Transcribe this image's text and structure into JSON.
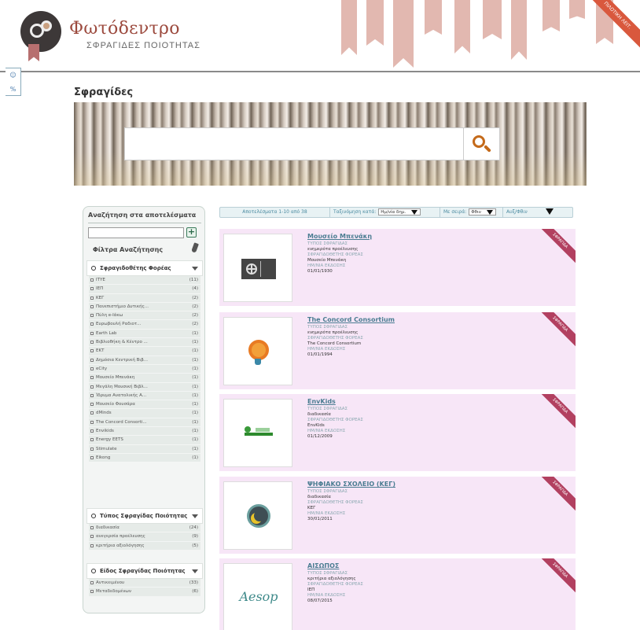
{
  "header": {
    "site_title": "Φωτόδεντρο",
    "site_subtitle": "ΣΦΡΑΓΙΔΕΣ ΠΟΙΟΤΗΤΑΣ",
    "corner_ribbon": "ΠΙΛΟΤΙΚΗ ΛΕΙΤ.",
    "side_widget": [
      "☺",
      "%"
    ]
  },
  "page_title": "Σφραγίδες",
  "search": {
    "value": "",
    "placeholder": ""
  },
  "filters": {
    "title": "Αναζήτηση στα αποτελέσματα",
    "search_value": "",
    "add_label": "+",
    "label": "Φίλτρα Αναζήτησης",
    "groups": [
      {
        "title": "Σφραγιδοθέτης Φορέας",
        "items": [
          {
            "label": "ΙΤΥΕ",
            "count": "(11)"
          },
          {
            "label": "ΙΕΠ",
            "count": "(4)"
          },
          {
            "label": "ΚΕΓ",
            "count": "(2)"
          },
          {
            "label": "Πανεπιστήμιο Δυτικής...",
            "count": "(2)"
          },
          {
            "label": "Πύλη e-Ιάκω",
            "count": "(2)"
          },
          {
            "label": "Ευρωβουλή Ραδιοτ...",
            "count": "(2)"
          },
          {
            "label": "Earth Lab",
            "count": "(1)"
          },
          {
            "label": "Βιβλιοθήκη & Κέντρο ...",
            "count": "(1)"
          },
          {
            "label": "ΕΚΤ",
            "count": "(1)"
          },
          {
            "label": "Δημόσια Κεντρική Βιβ...",
            "count": "(1)"
          },
          {
            "label": "eCity",
            "count": "(1)"
          },
          {
            "label": "Μουσείο Μπενάκη",
            "count": "(1)"
          },
          {
            "label": "Μεγάλη Μουσική Βιβλ...",
            "count": "(1)"
          },
          {
            "label": "Ίδρυμα Ανατολικής Α...",
            "count": "(1)"
          },
          {
            "label": "Μουσείο Φουσάρα",
            "count": "(1)"
          },
          {
            "label": "dMinds",
            "count": "(1)"
          },
          {
            "label": "The Concord Consorti...",
            "count": "(1)"
          },
          {
            "label": "Envikids",
            "count": "(1)"
          },
          {
            "label": "Energy EETS",
            "count": "(1)"
          },
          {
            "label": "Stimulate",
            "count": "(1)"
          },
          {
            "label": "Eikong",
            "count": "(1)"
          }
        ]
      },
      {
        "title": "Τύπος Σφραγίδας Ποιότητας",
        "items": [
          {
            "label": "διαδικασία",
            "count": "(24)"
          },
          {
            "label": "ανεγερσία προέλευσης",
            "count": "(9)"
          },
          {
            "label": "κριτήρια αξιολόγησης",
            "count": "(5)"
          }
        ]
      },
      {
        "title": "Είδος Σφραγίδας Ποιότητας",
        "items": [
          {
            "label": "Αντικειμένου",
            "count": "(33)"
          },
          {
            "label": "Μεταδεδομένων",
            "count": "(6)"
          }
        ]
      }
    ]
  },
  "toolbar": {
    "results_text": "Αποτελέσματα 1-10 από 38",
    "sort_label": "Ταξινόμηση κατά:",
    "sort_value": "Ημ/νία δημ.",
    "order_label": "Με σειρά:",
    "order_value": "Φθιν",
    "direction_label": "Αυξ/Φθιν"
  },
  "results": [
    {
      "title": "Μουσείο Μπενάκη",
      "type_label": "ΤΥΠΟΣ ΣΦΡΑΓΙΔΑΣ",
      "type_value": "ενημερότα προέλευσης",
      "org_label": "ΣΦΡΑΓΙΔΟΘΕΤΗΣ ΦΟΡΕΑΣ",
      "org_value": "Μουσείο Μπενάκη",
      "date_label": "ΗΜ/ΝΙΑ ΕΚΔΟΣΗΣ",
      "date_value": "01/01/1930",
      "ribbon": "ΣΦΡΑΓΙΔΑ",
      "thumb": "museum-logo"
    },
    {
      "title": "The Concord Consortium",
      "type_label": "ΤΥΠΟΣ ΣΦΡΑΓΙΔΑΣ",
      "type_value": "ενημερότα προέλευσης",
      "org_label": "ΣΦΡΑΓΙΔΟΘΕΤΗΣ ΦΟΡΕΑΣ",
      "org_value": "The Concord Consortium",
      "date_label": "ΗΜ/ΝΙΑ ΕΚΔΟΣΗΣ",
      "date_value": "01/01/1994",
      "ribbon": "ΣΦΡΑΓΙΔΑ",
      "thumb": "bulb-logo"
    },
    {
      "title": "EnvKids",
      "type_label": "ΤΥΠΟΣ ΣΦΡΑΓΙΔΑΣ",
      "type_value": "διαδικασία",
      "org_label": "ΣΦΡΑΓΙΔΟΘΕΤΗΣ ΦΟΡΕΑΣ",
      "org_value": "EnvKids",
      "date_label": "ΗΜ/ΝΙΑ ΕΚΔΟΣΗΣ",
      "date_value": "01/12/2009",
      "ribbon": "ΣΦΡΑΓΙΔΑ",
      "thumb": "kids-logo"
    },
    {
      "title": "ΨΗΦΙΑΚΟ ΣΧΟΛΕΙΟ (ΚΕΓ)",
      "type_label": "ΤΥΠΟΣ ΣΦΡΑΓΙΔΑΣ",
      "type_value": "διαδικασία",
      "org_label": "ΣΦΡΑΓΙΔΟΘΕΤΗΣ ΦΟΡΕΑΣ",
      "org_value": "ΚΕΓ",
      "date_label": "ΗΜ/ΝΙΑ ΕΚΔΟΣΗΣ",
      "date_value": "30/01/2011",
      "ribbon": "ΣΦΡΑΓΙΔΑ",
      "thumb": "moon-logo"
    },
    {
      "title": "ΑΙΣΩΠΟΣ",
      "type_label": "ΤΥΠΟΣ ΣΦΡΑΓΙΔΑΣ",
      "type_value": "κριτήρια αξιολόγησης",
      "org_label": "ΣΦΡΑΓΙΔΟΘΕΤΗΣ ΦΟΡΕΑΣ",
      "org_value": "ΙΕΠ",
      "date_label": "ΗΜ/ΝΙΑ ΕΚΔΟΣΗΣ",
      "date_value": "08/07/2015",
      "ribbon": "ΣΦΡΑΓΙΔΑ",
      "thumb": "aesop-logo",
      "thumb_text": "Aesop"
    }
  ],
  "colors": {
    "title_red": "#9c4a3e",
    "result_bg": "#f7e6f7",
    "link": "#4b7d92",
    "ribbon": "#b24060"
  }
}
